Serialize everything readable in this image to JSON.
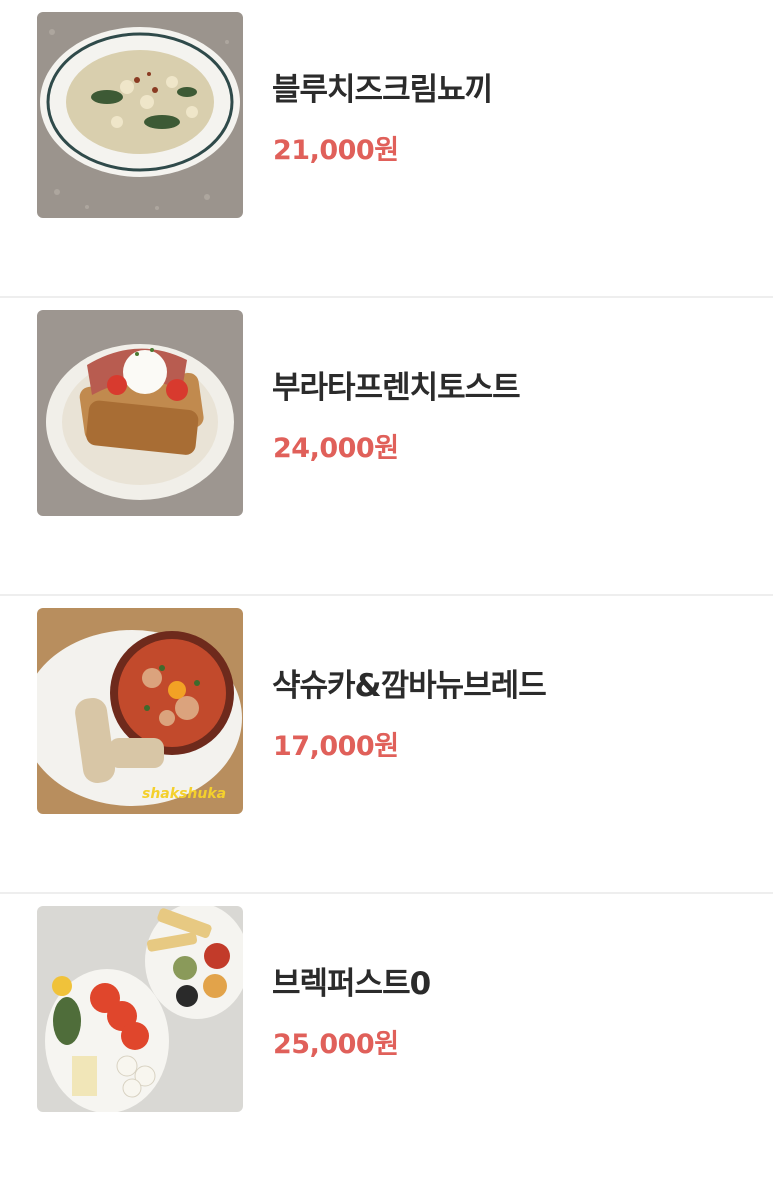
{
  "menu": {
    "items": [
      {
        "name": "블루치즈크림뇨끼",
        "price": "21,000원",
        "image": "gnocchi-plate"
      },
      {
        "name": "부라타프렌치토스트",
        "price": "24,000원",
        "image": "french-toast-plate"
      },
      {
        "name": "샥슈카&깜바뉴브레드",
        "price": "17,000원",
        "image": "shakshuka-pan",
        "image_caption": "shakshuka"
      },
      {
        "name": "브렉퍼스트0",
        "price": "25,000원",
        "image": "breakfast-platter"
      }
    ]
  }
}
